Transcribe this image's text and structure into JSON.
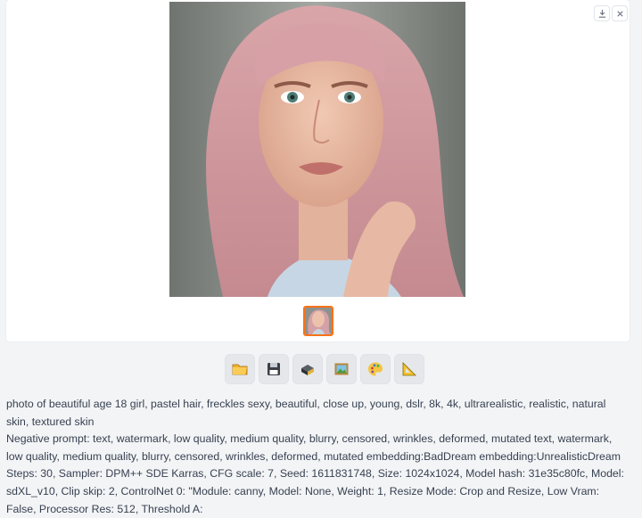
{
  "gallery": {
    "main_image_label": "photo of beautiful age 18 girl with pastel pink hair and freckles",
    "thumbnail_label": "thumbnail of generated image",
    "download_icon": "download-icon",
    "close_icon": "close-icon",
    "accent_color": "#f97316"
  },
  "toolbar": {
    "buttons": [
      {
        "name": "open-folder-button",
        "icon": "folder-icon",
        "glyph": "📂"
      },
      {
        "name": "save-button",
        "icon": "floppy-disk-icon",
        "glyph": "💾"
      },
      {
        "name": "zip-button",
        "icon": "archive-box-icon",
        "glyph": "🗜"
      },
      {
        "name": "send-to-img2img-button",
        "icon": "framed-picture-icon",
        "glyph": "🖼"
      },
      {
        "name": "send-to-inpaint-button",
        "icon": "palette-icon",
        "glyph": "🎨"
      },
      {
        "name": "send-to-extras-button",
        "icon": "triangular-ruler-icon",
        "glyph": "📐"
      }
    ]
  },
  "generation_info": {
    "prompt": "photo of beautiful age 18 girl, pastel hair, freckles sexy, beautiful, close up, young, dslr, 8k, 4k, ultrarealistic, realistic, natural skin, textured skin",
    "negative_prompt": "Negative prompt: text, watermark, low quality, medium quality, blurry, censored, wrinkles, deformed, mutated text, watermark, low quality, medium quality, blurry, censored, wrinkles, deformed, mutated embedding:BadDream embedding:UnrealisticDream",
    "params": "Steps: 30, Sampler: DPM++ SDE Karras, CFG scale: 7, Seed: 1611831748, Size: 1024x1024, Model hash: 31e35c80fc, Model: sdXL_v10, Clip skip: 2, ControlNet 0: \"Module: canny, Model: None, Weight: 1, Resize Mode: Crop and Resize, Low Vram: False, Processor Res: 512, Threshold A:"
  }
}
